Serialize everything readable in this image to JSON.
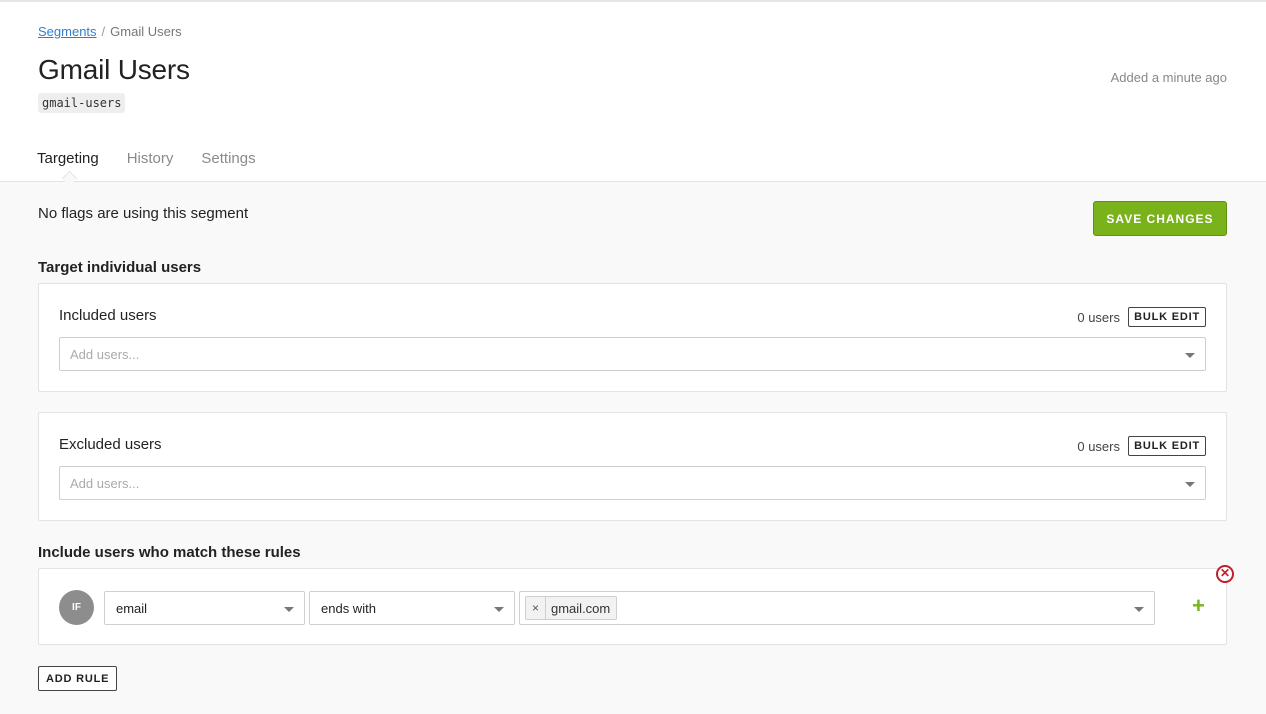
{
  "breadcrumb": {
    "parent": "Segments",
    "separator": "/",
    "current": "Gmail Users"
  },
  "segment": {
    "title": "Gmail Users",
    "key": "gmail-users",
    "added": "Added a minute ago"
  },
  "tabs": [
    {
      "label": "Targeting"
    },
    {
      "label": "History"
    },
    {
      "label": "Settings"
    }
  ],
  "active_tab": "Targeting",
  "notice": "No flags are using this segment",
  "save_label": "SAVE CHANGES",
  "individual": {
    "title": "Target individual users",
    "included": {
      "label": "Included users",
      "count": "0 users",
      "bulk_label": "BULK EDIT",
      "placeholder": "Add users..."
    },
    "excluded": {
      "label": "Excluded users",
      "count": "0 users",
      "bulk_label": "BULK EDIT",
      "placeholder": "Add users..."
    }
  },
  "rules": {
    "title": "Include users who match these rules",
    "items": [
      {
        "if_label": "IF",
        "attribute": "email",
        "operator": "ends with",
        "values": [
          "gmail.com"
        ],
        "tag_remove": "×",
        "add": "+",
        "remove": "✕"
      }
    ],
    "add_label": "ADD RULE"
  },
  "colors": {
    "accent": "#7ab21b",
    "link": "#2f7fd1",
    "danger": "#c0202a"
  },
  "icons": {
    "caret": "chevron-down-icon",
    "add": "plus-icon",
    "remove": "close-circle-icon"
  }
}
